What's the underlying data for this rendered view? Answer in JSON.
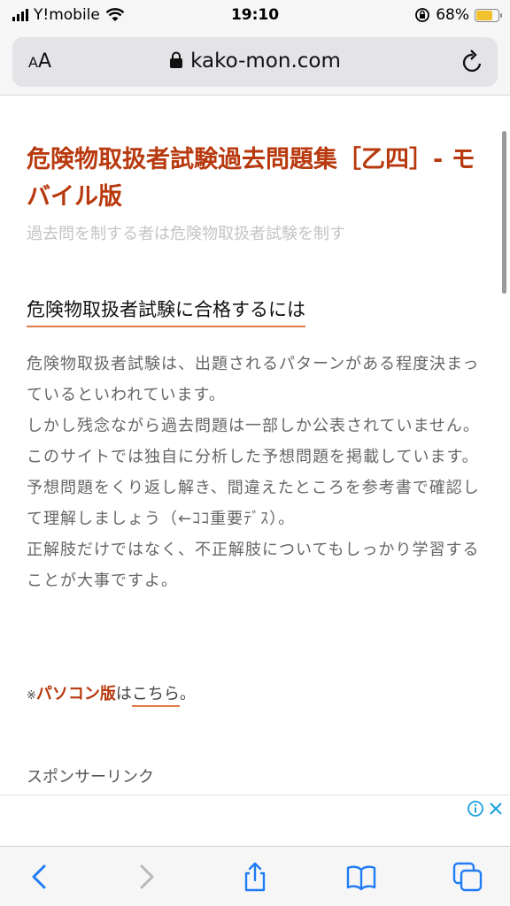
{
  "status_bar": {
    "carrier": "Y!mobile",
    "time": "19:10",
    "battery_percent": "68%",
    "battery_level": 0.68
  },
  "address_bar": {
    "text_size_label": "AA",
    "url": "kako-mon.com",
    "icons": [
      "lock-icon",
      "reload-icon"
    ]
  },
  "page": {
    "site_title": "危険物取扱者試験過去問題集［乙四］- モバイル版",
    "tagline": "過去問を制する者は危険物取扱者試験を制す",
    "heading": "危険物取扱者試験に合格するには",
    "paragraphs": [
      "危険物取扱者試験は、出題されるパターンがある程度決まっているといわれています。",
      "しかし残念ながら過去問題は一部しか公表されていません。",
      "このサイトでは独自に分析した予想問題を掲載しています。",
      "予想問題をくり返し解き、間違えたところを参考書で確認して理解しましょう（←ｺｺ重要ﾃﾞｽ）。",
      "正解肢だけではなく、不正解肢についてもしっかり学習することが大事ですよ。"
    ],
    "pc_note": {
      "mark": "※",
      "strong": "パソコン版",
      "middle": "は",
      "link": "こちら",
      "end": "。"
    },
    "sponsor_label": "スポンサーリンク"
  },
  "ad": {
    "icons": [
      "info-icon",
      "close-icon"
    ],
    "accent_color": "#1aa1e0"
  },
  "toolbar": {
    "icons": [
      "back-icon",
      "forward-icon",
      "share-icon",
      "bookmarks-icon",
      "tabs-icon"
    ],
    "accent_color": "#1f7cf5"
  },
  "colors": {
    "title": "#b8390e",
    "underline": "#e07b4a",
    "body_text": "#666666",
    "tagline": "#c4c4c4"
  }
}
